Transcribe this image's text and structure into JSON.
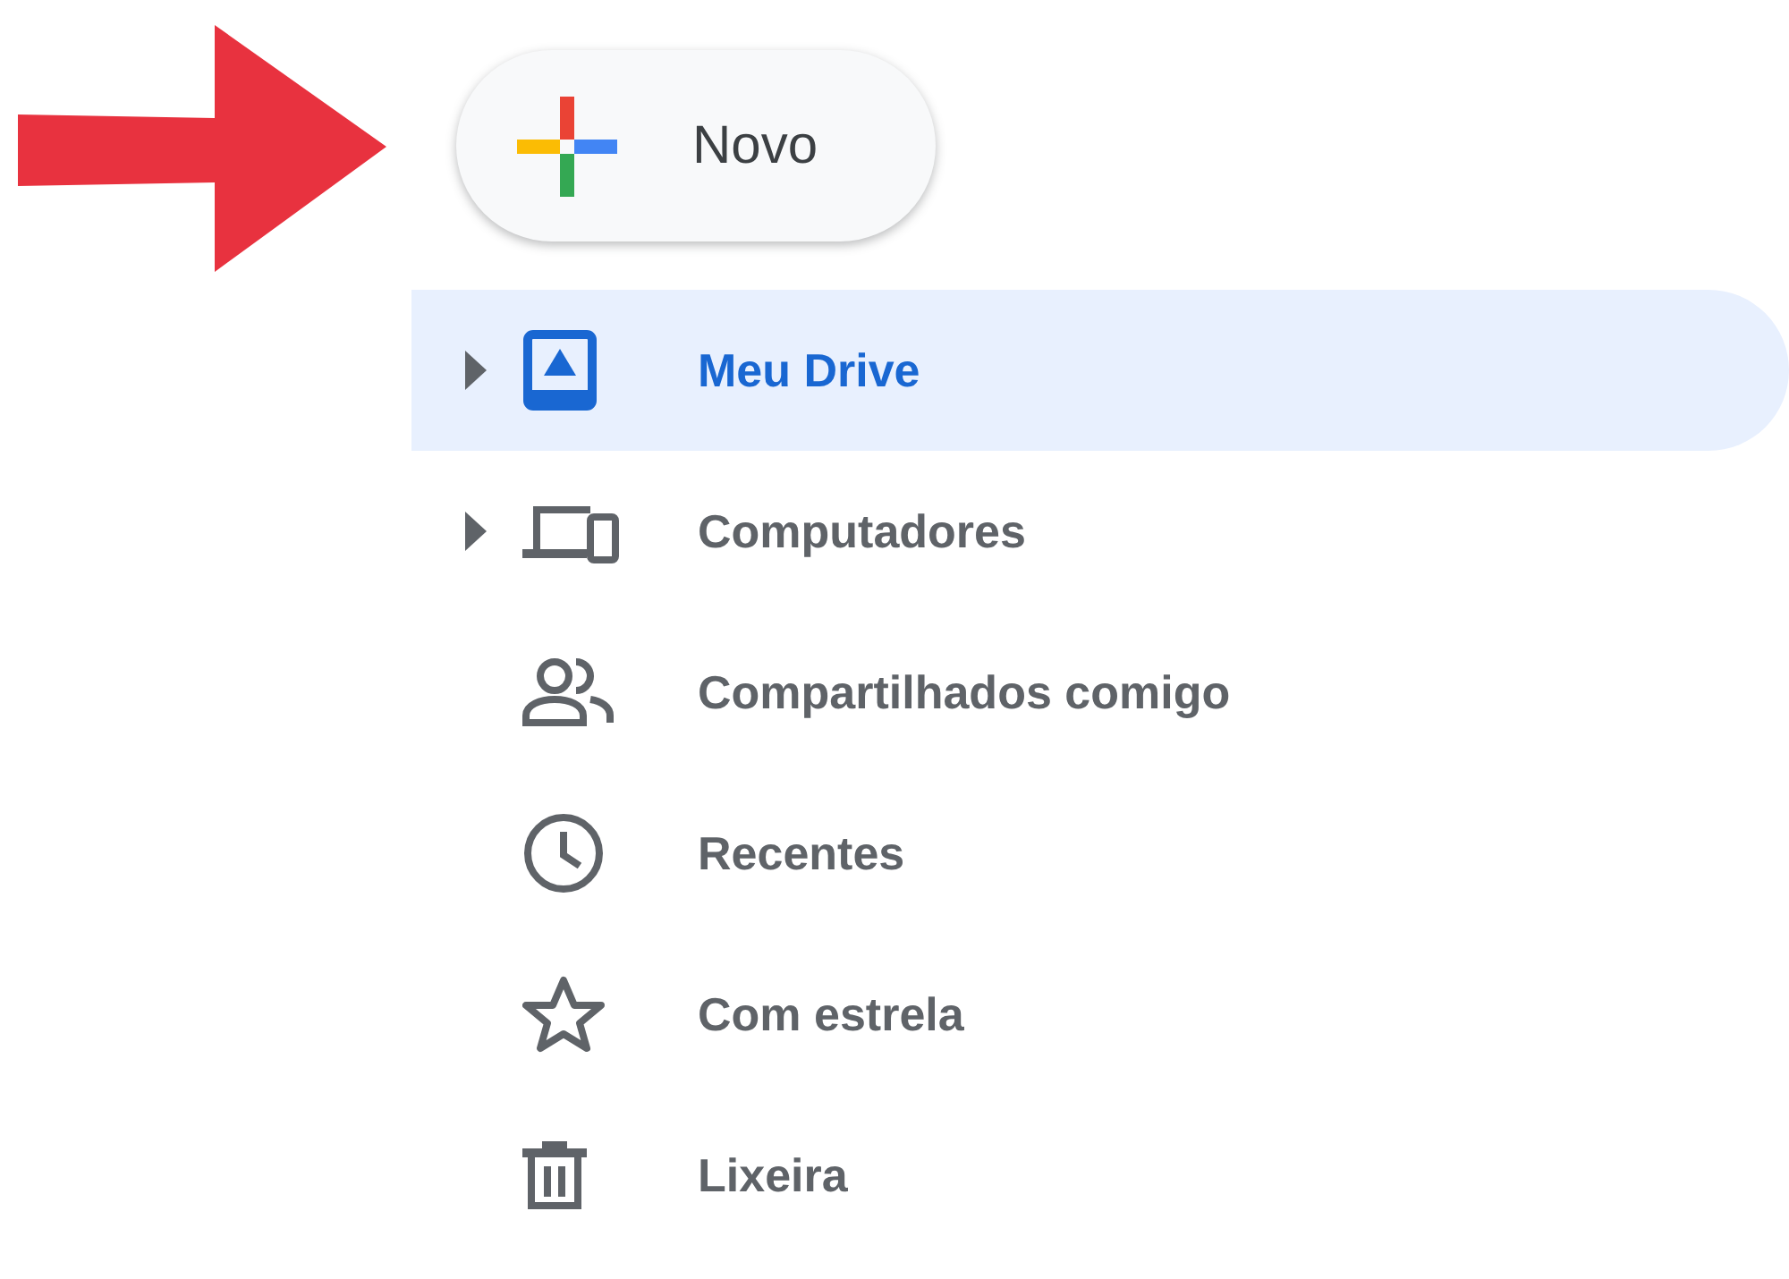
{
  "new_button": {
    "label": "Novo"
  },
  "nav": [
    {
      "kind": "drive",
      "label": "Meu Drive",
      "selected": true,
      "expandable": true
    },
    {
      "kind": "computers",
      "label": "Computadores",
      "selected": false,
      "expandable": true
    },
    {
      "kind": "shared",
      "label": "Compartilhados comigo",
      "selected": false,
      "expandable": false
    },
    {
      "kind": "recent",
      "label": "Recentes",
      "selected": false,
      "expandable": false
    },
    {
      "kind": "starred",
      "label": "Com estrela",
      "selected": false,
      "expandable": false
    },
    {
      "kind": "trash",
      "label": "Lixeira",
      "selected": false,
      "expandable": false
    }
  ]
}
